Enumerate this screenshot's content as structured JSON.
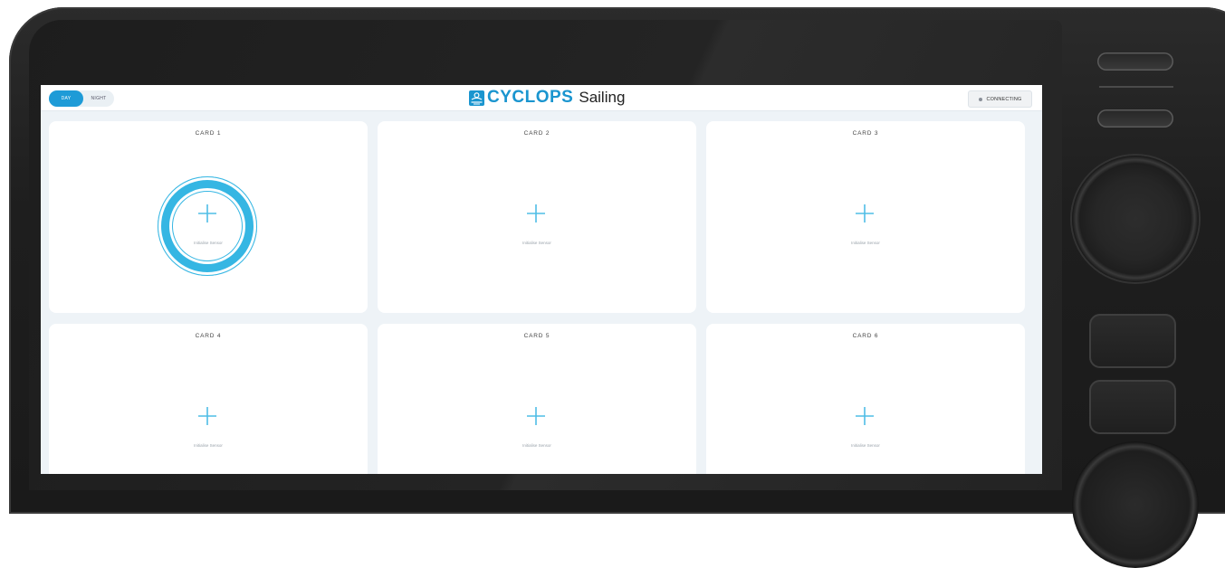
{
  "topbar": {
    "mode_day": "DAY",
    "mode_night": "NIGHT",
    "brand": "CYCLOPS",
    "product": "Sailing",
    "status": "CONNECTING"
  },
  "cards": [
    {
      "title": "CARD 1",
      "label": "Initialise Sensor",
      "highlighted": true
    },
    {
      "title": "CARD 2",
      "label": "Initialise Sensor",
      "highlighted": false
    },
    {
      "title": "CARD 3",
      "label": "Initialise Sensor",
      "highlighted": false
    },
    {
      "title": "CARD 4",
      "label": "Initialise Sensor",
      "highlighted": false
    },
    {
      "title": "CARD 5",
      "label": "Initialise Sensor",
      "highlighted": false
    },
    {
      "title": "CARD 6",
      "label": "Initialise Sensor",
      "highlighted": false
    }
  ],
  "icons": {
    "add": "plus-icon",
    "logo": "cyclops-logo-icon",
    "status": "status-dot-icon"
  },
  "colors": {
    "accent": "#1e9bd7",
    "highlight": "#35b6e3",
    "screen_bg": "#eef3f7",
    "bezel": "#1e1e1e"
  }
}
